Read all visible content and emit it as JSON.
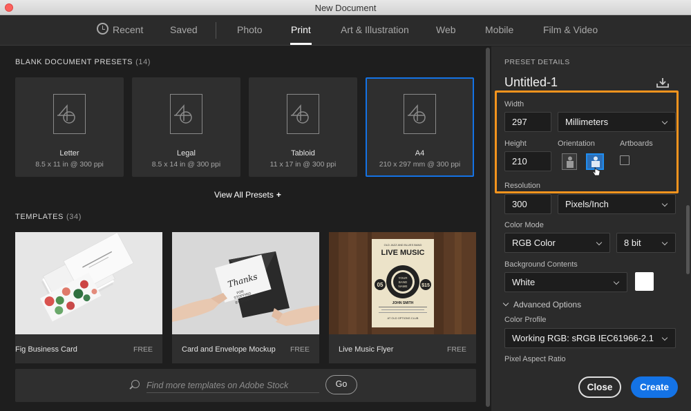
{
  "window": {
    "title": "New Document"
  },
  "tabs": [
    {
      "label": "Recent",
      "icon": "clock-icon"
    },
    {
      "label": "Saved"
    },
    {
      "label": "Photo"
    },
    {
      "label": "Print",
      "active": true
    },
    {
      "label": "Art & Illustration"
    },
    {
      "label": "Web"
    },
    {
      "label": "Mobile"
    },
    {
      "label": "Film & Video"
    }
  ],
  "presets_section": {
    "title": "BLANK DOCUMENT PRESETS",
    "count": "(14)"
  },
  "presets": [
    {
      "name": "Letter",
      "desc": "8.5 x 11 in @ 300 ppi"
    },
    {
      "name": "Legal",
      "desc": "8.5 x 14 in @ 300 ppi"
    },
    {
      "name": "Tabloid",
      "desc": "11 x 17 in @ 300 ppi"
    },
    {
      "name": "A4",
      "desc": "210 x 297 mm @ 300 ppi",
      "selected": true
    }
  ],
  "view_all": {
    "label": "View All Presets"
  },
  "templates_section": {
    "title": "TEMPLATES",
    "count": "(34)"
  },
  "templates": [
    {
      "name": "Fig Business Card",
      "badge": "FREE"
    },
    {
      "name": "Card and Envelope Mockup",
      "badge": "FREE"
    },
    {
      "name": "Live Music Flyer",
      "badge": "FREE"
    }
  ],
  "thumb_text": {
    "thanks_1": "Thanks",
    "thanks_2": "FOR",
    "thanks_3": "STOPPING",
    "thanks_4": "BY STUDIO",
    "flyer_top": "OLD JAZZ AND BLUES BAND",
    "flyer_title": "LIVE MUSIC",
    "flyer_left": "05",
    "flyer_right": "$15",
    "flyer_center_1": "YOUR",
    "flyer_center_2": "BAND",
    "flyer_center_3": "NAME",
    "flyer_band": "JOHN SMITH",
    "flyer_bottom": "AT OLD OPTIONS CLUB"
  },
  "search": {
    "placeholder": "Find more templates on Adobe Stock",
    "go_label": "Go"
  },
  "details": {
    "header": "PRESET DETAILS",
    "doc_name": "Untitled-1",
    "width_label": "Width",
    "width_value": "297",
    "unit": "Millimeters",
    "height_label": "Height",
    "height_value": "210",
    "orientation_label": "Orientation",
    "orientation_selected": "landscape",
    "artboards_label": "Artboards",
    "artboards_checked": false,
    "resolution_label": "Resolution",
    "resolution_value": "300",
    "resolution_unit": "Pixels/Inch",
    "color_mode_label": "Color Mode",
    "color_mode": "RGB Color",
    "bit_depth": "8 bit",
    "background_label": "Background Contents",
    "background": "White",
    "background_swatch": "#ffffff",
    "advanced_label": "Advanced Options",
    "color_profile_label": "Color Profile",
    "color_profile": "Working RGB: sRGB IEC61966-2.1",
    "pixel_aspect_label": "Pixel Aspect Ratio"
  },
  "buttons": {
    "close": "Close",
    "create": "Create"
  },
  "colors": {
    "accent": "#1473e6",
    "highlight": "#f7941d",
    "background": "#1e1e1e",
    "panel": "#2b2b2b"
  }
}
